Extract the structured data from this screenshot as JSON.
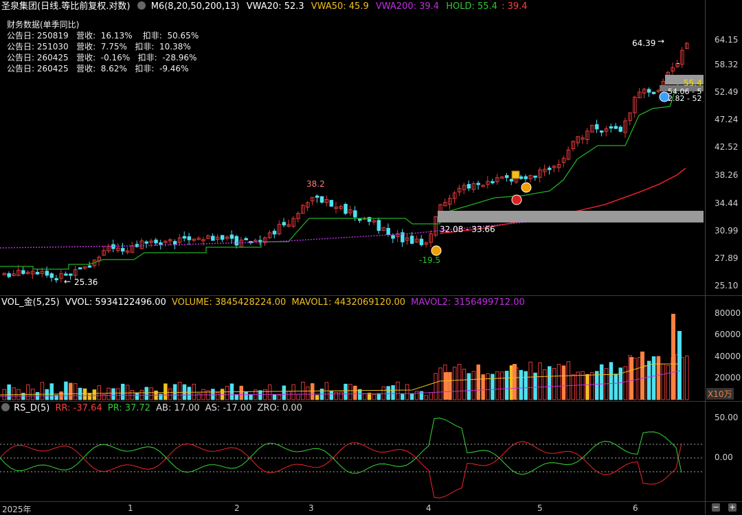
{
  "title_bar": {
    "stock": "圣泉集团(日线.等比前复权.对数)",
    "indicator": "M6(8,20,50,200,13)",
    "vwa20": "VWA20: 52.3",
    "vwa50": "VWA50: 45.9",
    "vwa200": "VWA200: 39.4",
    "hold": "HOLD: 55.4",
    "hold_value": ": 39.4"
  },
  "finance": {
    "heading": "财务数据(单季同比)",
    "rows": [
      "公告日: 250819   营收:  16.13%    扣非:  50.65%",
      "公告日: 251030   营收:  7.75%   扣非:  10.38%",
      "公告日: 260425   营收:  -0.16%   扣非:  -28.96%",
      "公告日: 260425   营收:  8.62%   扣非:  -9.46%"
    ]
  },
  "price_axis": [
    "64.15",
    "58.32",
    "52.49",
    "47.24",
    "42.52",
    "38.26",
    "34.44",
    "30.99",
    "27.89",
    "25.10"
  ],
  "annotations": {
    "low": "25.36",
    "mid_high": "38.2",
    "high": "64.39",
    "zone": "32.08 - 33.66",
    "hold_tag": "55.4",
    "upper_zone_1": "54.06 - 5",
    "upper_zone_2": "2.82 - 52",
    "dip": "-19.5",
    "dash": "-"
  },
  "volume_header": {
    "name": "VOL_金(5,25)",
    "vvol": "VVOL: 5934122496.00",
    "volume": "VOLUME: 3845428224.00",
    "mavol1": "MAVOL1: 4432069120.00",
    "mavol2": "MAVOL2: 3156499712.00"
  },
  "volume_axis": [
    "80000",
    "60000",
    "40000",
    "20000"
  ],
  "volume_unit": "X10万",
  "rs_header": {
    "name": "RS_D(5)",
    "rr": "RR: -37.64",
    "pr": "PR: 37.72",
    "ab": "AB: 17.00",
    "as": "AS: -17.00",
    "zro": "ZRO: 0.00"
  },
  "rs_axis": [
    "50.00",
    "0.00"
  ],
  "time_axis": [
    "2025年",
    "1",
    "2",
    "3",
    "4",
    "5",
    "6"
  ],
  "colors": {
    "up": "#e03a3a",
    "down": "#4fe0f0",
    "ma_green": "#22b022",
    "ma_red": "#e0202a",
    "ma_purple": "#c030e0",
    "yellow": "#f0c020",
    "orange": "#ff8040",
    "hold_green": "#35c735"
  }
}
